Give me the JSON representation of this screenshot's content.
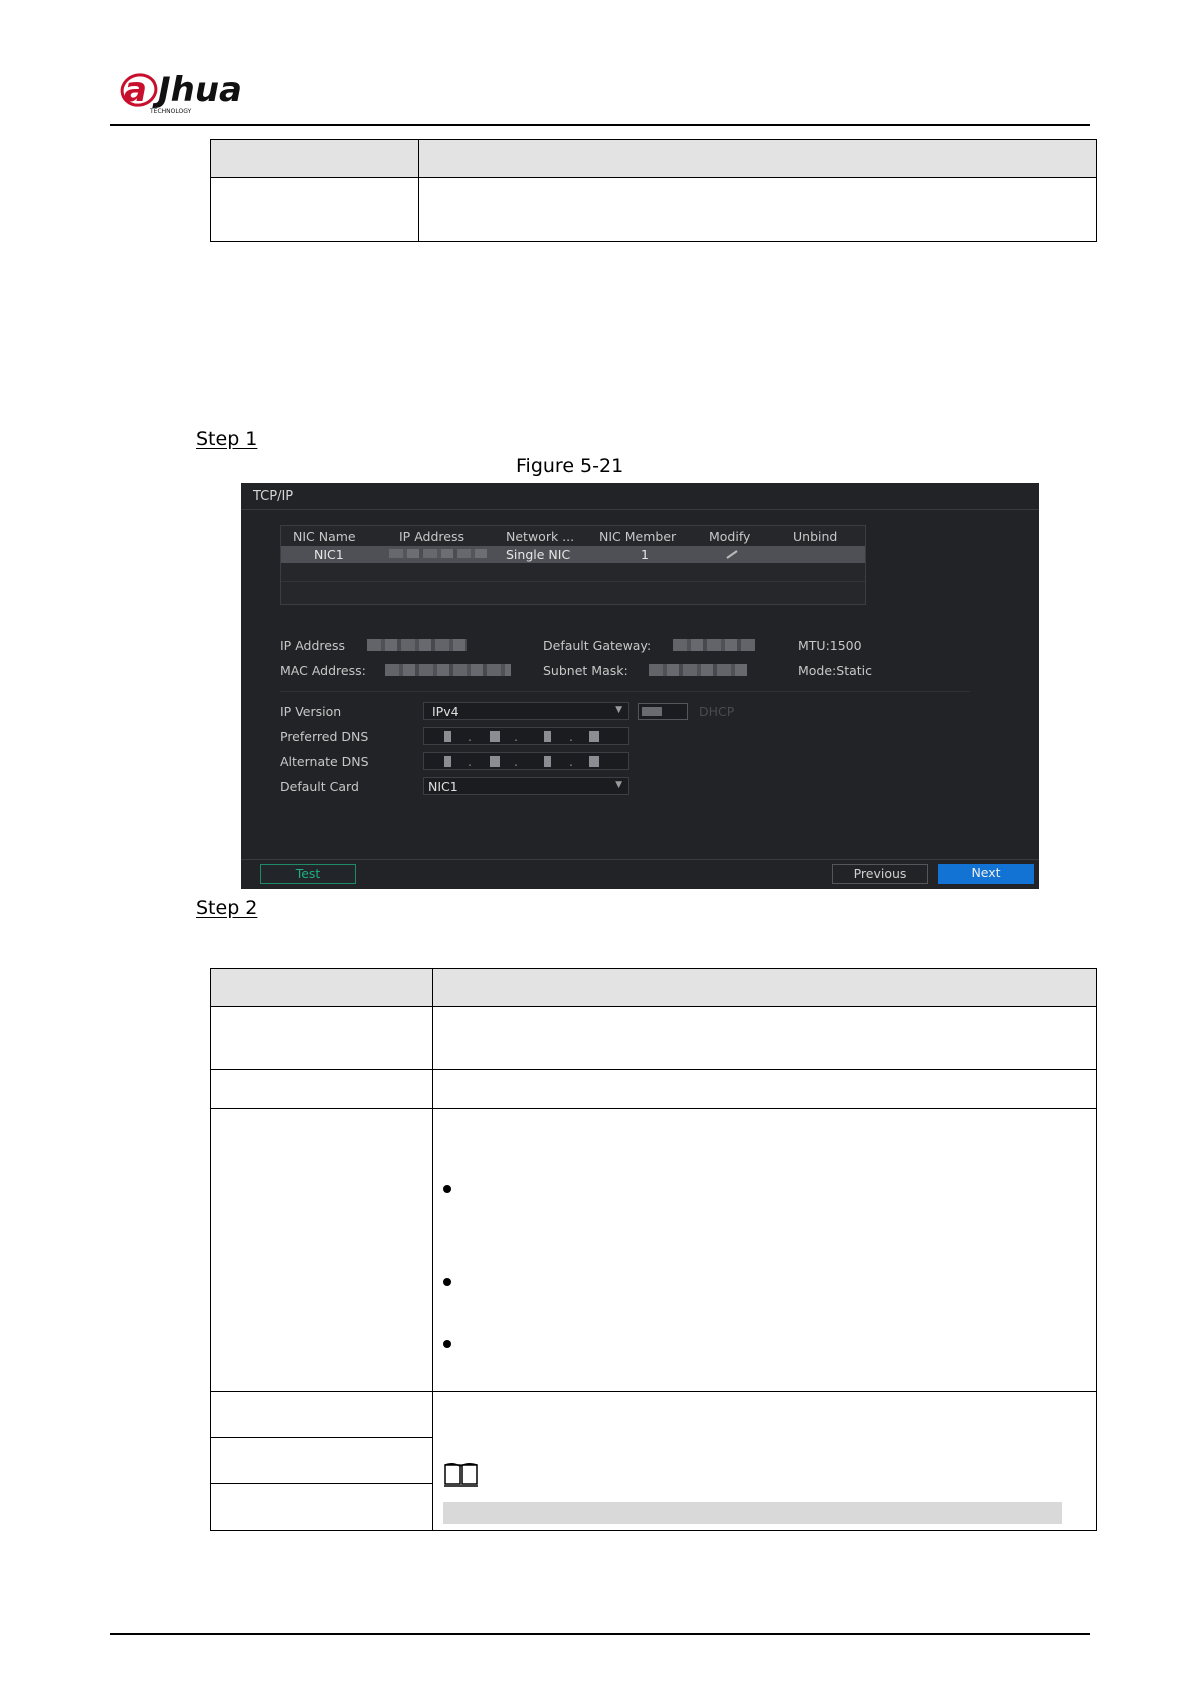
{
  "header": {
    "logo_text": "alhua",
    "logo_subtext": "TECHNOLOGY"
  },
  "steps": {
    "step1": "Step 1",
    "step2": "Step 2"
  },
  "figure": {
    "caption": "Figure 5-21"
  },
  "tcpip": {
    "title": "TCP/IP",
    "columns": [
      "NIC Name",
      "IP Address",
      "Network ...",
      "NIC Member",
      "Modify",
      "Unbind"
    ],
    "row": {
      "nic_name": "NIC1",
      "network": "Single NIC",
      "nic_member": "1"
    },
    "info": {
      "ip_address_label": "IP Address",
      "mac_address_label": "MAC Address:",
      "default_gateway_label": "Default Gateway:",
      "subnet_mask_label": "Subnet Mask:",
      "mtu": "MTU:1500",
      "mode": "Mode:Static"
    },
    "form": {
      "ip_version_label": "IP Version",
      "ip_version_value": "IPv4",
      "dhcp_label": "DHCP",
      "preferred_dns_label": "Preferred DNS",
      "alternate_dns_label": "Alternate DNS",
      "default_card_label": "Default Card",
      "default_card_value": "NIC1"
    },
    "buttons": {
      "test": "Test",
      "previous": "Previous",
      "next": "Next"
    }
  }
}
